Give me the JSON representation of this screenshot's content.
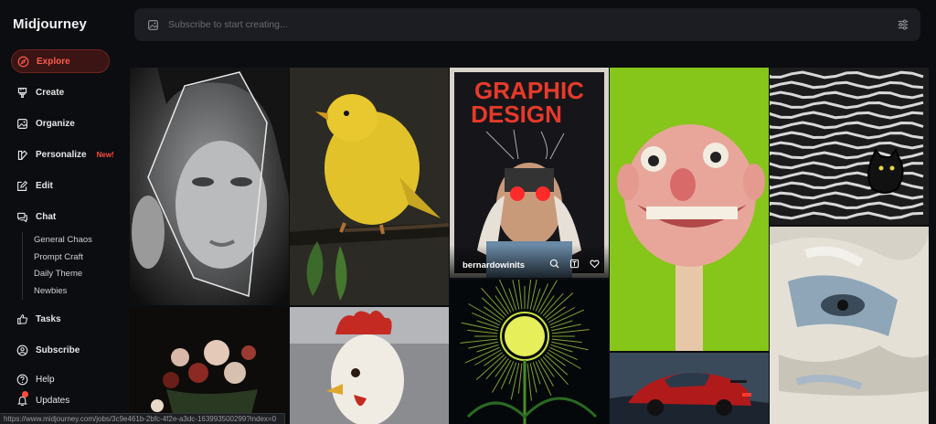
{
  "app": {
    "title": "Midjourney"
  },
  "sidebar": {
    "items": [
      {
        "label": "Explore",
        "icon": "compass-icon",
        "active": true
      },
      {
        "label": "Create",
        "icon": "brush-icon"
      },
      {
        "label": "Organize",
        "icon": "image-icon"
      },
      {
        "label": "Personalize",
        "icon": "palette-icon",
        "badge": "New!"
      },
      {
        "label": "Edit",
        "icon": "edit-icon"
      },
      {
        "label": "Chat",
        "icon": "chat-icon"
      },
      {
        "label": "Tasks",
        "icon": "thumbs-up-icon"
      },
      {
        "label": "Subscribe",
        "icon": "user-circle-icon"
      },
      {
        "label": "Help",
        "icon": "help-icon"
      },
      {
        "label": "Updates",
        "icon": "bell-icon"
      }
    ],
    "chat_channels": [
      "General Chaos",
      "Prompt Craft",
      "Daily Theme",
      "Newbies"
    ]
  },
  "search": {
    "placeholder": "Subscribe to start creating..."
  },
  "gallery": {
    "featured": {
      "title_line1": "GRAPHIC",
      "title_line2": "DESIGN",
      "author": "bernardowinits"
    }
  },
  "status_url": "https://www.midjourney.com/jobs/3c9e461b-2bfc-4f2e-a3dc-163993500299?index=0",
  "colors": {
    "accent": "#ff4d3d",
    "background": "#0c0d10",
    "search_bg": "#1c1d22"
  }
}
